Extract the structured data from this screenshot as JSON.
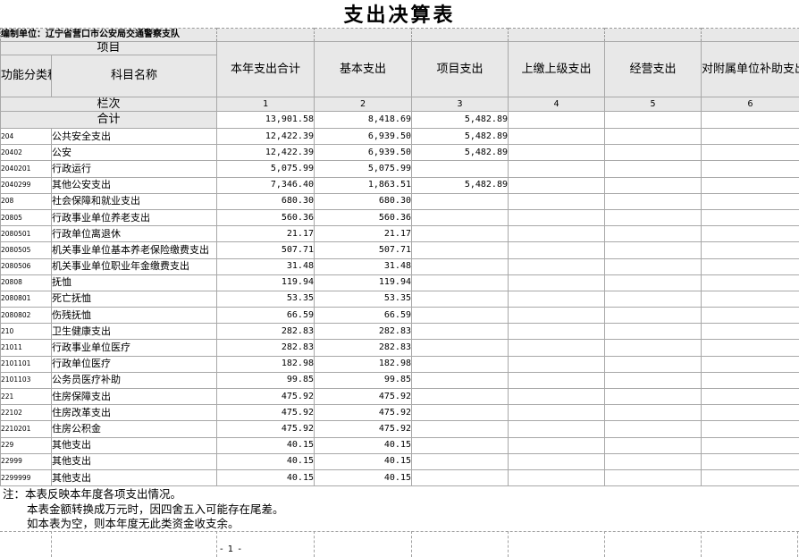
{
  "title": "支出决算表",
  "unit": "编制单位：辽宁省营口市公安局交通警察支队",
  "header": {
    "project_label": "项目",
    "code_label": "功能分类科目编码",
    "name_label": "科目名称",
    "columns": [
      "本年支出合计",
      "基本支出",
      "项目支出",
      "上缴上级支出",
      "经营支出",
      "对附属单位补助支出"
    ],
    "index_label": "栏次",
    "index": [
      "1",
      "2",
      "3",
      "4",
      "5",
      "6"
    ]
  },
  "total": {
    "label": "合计",
    "total": "13,901.58",
    "basic": "8,418.69",
    "project": "5,482.89"
  },
  "rows": [
    {
      "code": "204",
      "name": "公共安全支出",
      "total": "12,422.39",
      "basic": "6,939.50",
      "project": "5,482.89"
    },
    {
      "code": "20402",
      "name": "公安",
      "total": "12,422.39",
      "basic": "6,939.50",
      "project": "5,482.89"
    },
    {
      "code": "2040201",
      "name": "行政运行",
      "total": "5,075.99",
      "basic": "5,075.99"
    },
    {
      "code": "2040299",
      "name": "其他公安支出",
      "total": "7,346.40",
      "basic": "1,863.51",
      "project": "5,482.89"
    },
    {
      "code": "208",
      "name": "社会保障和就业支出",
      "total": "680.30",
      "basic": "680.30"
    },
    {
      "code": "20805",
      "name": "行政事业单位养老支出",
      "total": "560.36",
      "basic": "560.36"
    },
    {
      "code": "2080501",
      "name": "行政单位离退休",
      "total": "21.17",
      "basic": "21.17"
    },
    {
      "code": "2080505",
      "name": "机关事业单位基本养老保险缴费支出",
      "total": "507.71",
      "basic": "507.71"
    },
    {
      "code": "2080506",
      "name": "机关事业单位职业年金缴费支出",
      "total": "31.48",
      "basic": "31.48"
    },
    {
      "code": "20808",
      "name": "抚恤",
      "total": "119.94",
      "basic": "119.94"
    },
    {
      "code": "2080801",
      "name": "死亡抚恤",
      "total": "53.35",
      "basic": "53.35"
    },
    {
      "code": "2080802",
      "name": "伤残抚恤",
      "total": "66.59",
      "basic": "66.59"
    },
    {
      "code": "210",
      "name": "卫生健康支出",
      "total": "282.83",
      "basic": "282.83"
    },
    {
      "code": "21011",
      "name": "行政事业单位医疗",
      "total": "282.83",
      "basic": "282.83"
    },
    {
      "code": "2101101",
      "name": "行政单位医疗",
      "total": "182.98",
      "basic": "182.98"
    },
    {
      "code": "2101103",
      "name": "公务员医疗补助",
      "total": "99.85",
      "basic": "99.85"
    },
    {
      "code": "221",
      "name": "住房保障支出",
      "total": "475.92",
      "basic": "475.92"
    },
    {
      "code": "22102",
      "name": "住房改革支出",
      "total": "475.92",
      "basic": "475.92"
    },
    {
      "code": "2210201",
      "name": "住房公积金",
      "total": "475.92",
      "basic": "475.92"
    },
    {
      "code": "229",
      "name": "其他支出",
      "total": "40.15",
      "basic": "40.15"
    },
    {
      "code": "22999",
      "name": "其他支出",
      "total": "40.15",
      "basic": "40.15"
    },
    {
      "code": "2299999",
      "name": "其他支出",
      "total": "40.15",
      "basic": "40.15"
    }
  ],
  "notes": [
    "注：本表反映本年度各项支出情况。",
    "本表金额转换成万元时，因四舍五入可能存在尾差。",
    "如本表为空，则本年度无此类资金收支余。"
  ],
  "page_number": "- 1 -",
  "colors": {
    "grid": "#a8a8a8",
    "header_fill": "#d2d2d2",
    "text": "#000000"
  }
}
